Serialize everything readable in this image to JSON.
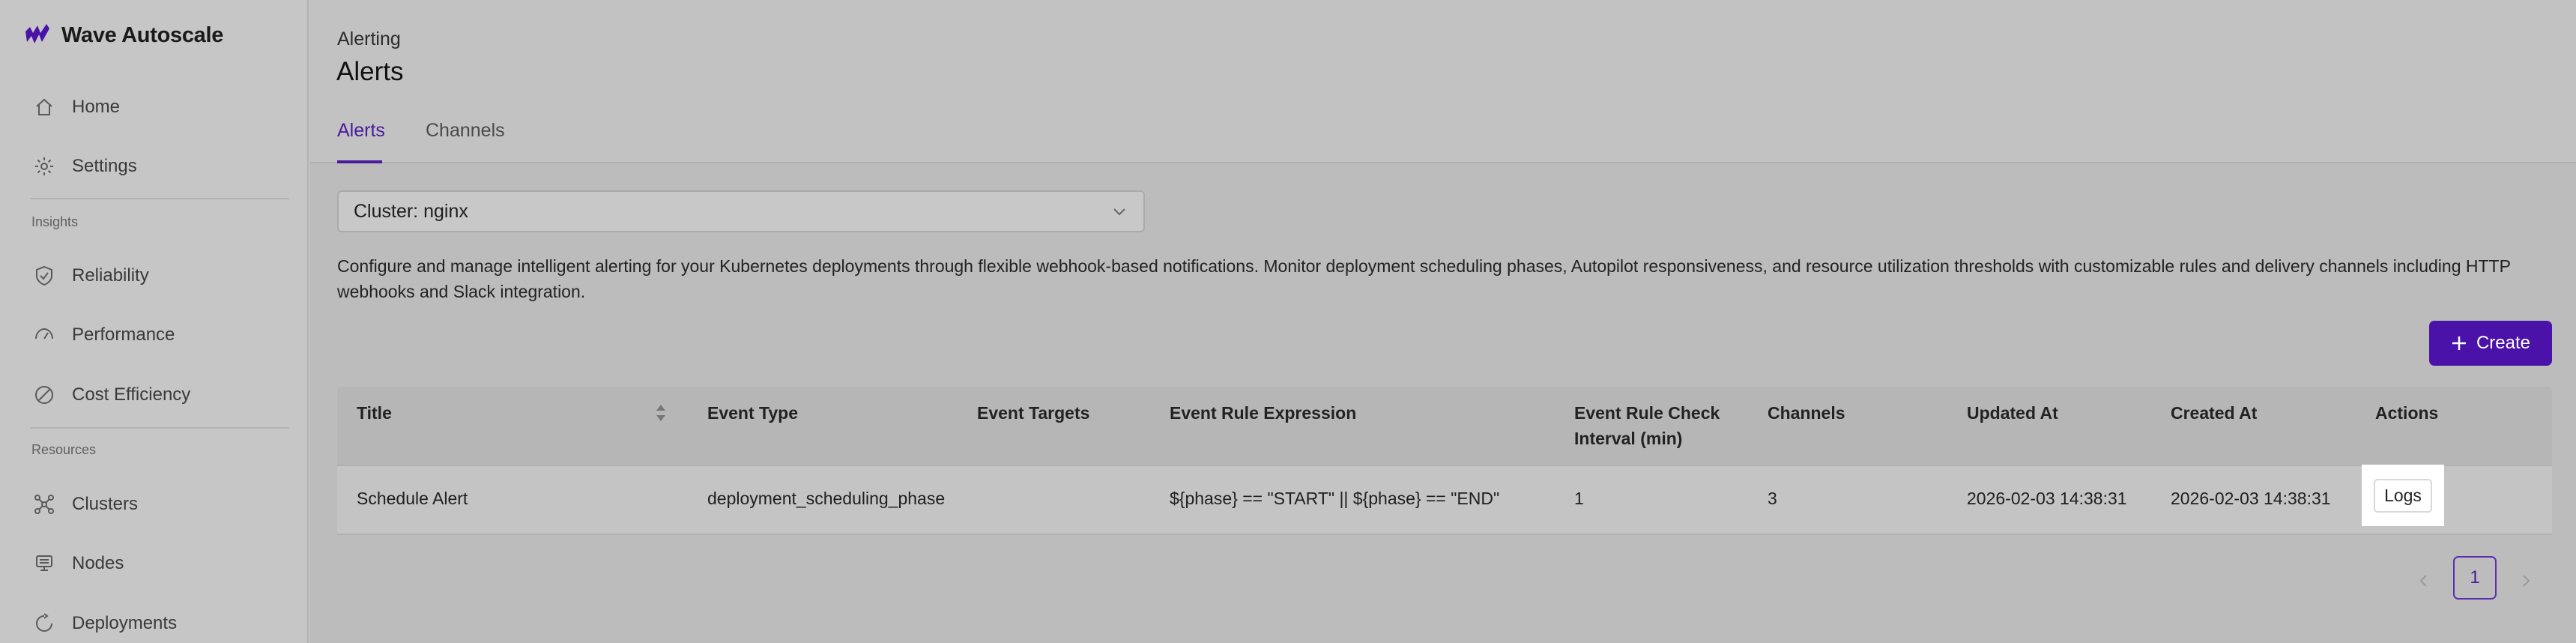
{
  "app": {
    "name": "Wave Autoscale",
    "brand_color": "#4a12a8"
  },
  "sidebar": {
    "items_top": [
      {
        "label": "Home",
        "icon": "home-icon"
      },
      {
        "label": "Settings",
        "icon": "gear-icon"
      }
    ],
    "insights_label": "Insights",
    "insights_items": [
      {
        "label": "Reliability",
        "icon": "shield-icon"
      },
      {
        "label": "Performance",
        "icon": "gauge-icon"
      },
      {
        "label": "Cost Efficiency",
        "icon": "cost-icon"
      }
    ],
    "resources_label": "Resources",
    "resources_items": [
      {
        "label": "Clusters",
        "icon": "clusters-icon"
      },
      {
        "label": "Nodes",
        "icon": "nodes-icon"
      },
      {
        "label": "Deployments",
        "icon": "deployments-icon"
      }
    ]
  },
  "header": {
    "breadcrumb": "Alerting",
    "title": "Alerts",
    "tabs": [
      {
        "label": "Alerts",
        "active": true
      },
      {
        "label": "Channels",
        "active": false
      }
    ]
  },
  "filters": {
    "cluster_select": "Cluster: nginx"
  },
  "description": "Configure and manage intelligent alerting for your Kubernetes deployments through flexible webhook-based notifications. Monitor deployment scheduling phases, Autopilot responsiveness, and resource utilization thresholds with customizable rules and delivery channels including HTTP webhooks and Slack integration.",
  "actions": {
    "create_label": "Create"
  },
  "table": {
    "columns": [
      "Title",
      "Event Type",
      "Event Targets",
      "Event Rule Expression",
      "Event Rule Check Interval (min)",
      "Channels",
      "Updated At",
      "Created At",
      "Actions"
    ],
    "rows": [
      {
        "title": "Schedule Alert",
        "event_type": "deployment_scheduling_phase",
        "event_targets": "",
        "event_rule_expression": "${phase} == \"START\" || ${phase} == \"END\"",
        "check_interval": "1",
        "channels": "3",
        "updated_at": "2026-02-03 14:38:31",
        "created_at": "2026-02-03 14:38:31",
        "action_label": "Logs"
      }
    ]
  },
  "pagination": {
    "current_page": "1"
  }
}
